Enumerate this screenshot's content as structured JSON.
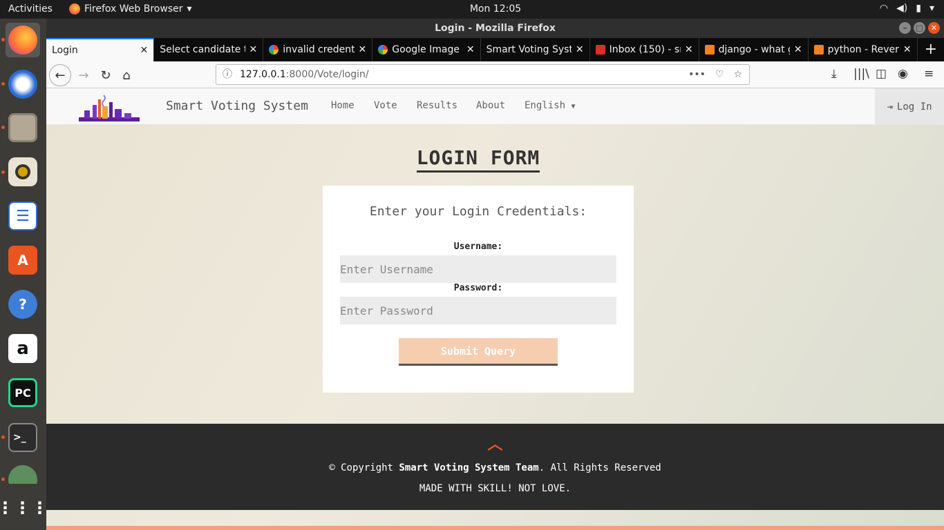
{
  "topbar": {
    "activities": "Activities",
    "app_name": "Firefox Web Browser",
    "clock": "Mon 12:05"
  },
  "window": {
    "title": "Login - Mozilla Firefox"
  },
  "tabs": [
    {
      "label": "Login",
      "active": true
    },
    {
      "label": "Select candidate t"
    },
    {
      "label": "invalid credent"
    },
    {
      "label": "Google Image"
    },
    {
      "label": "Smart Voting Syst"
    },
    {
      "label": "Inbox (150) - sr"
    },
    {
      "label": "django - what g"
    },
    {
      "label": "python - Rever"
    }
  ],
  "url": {
    "host": "127.0.0.1",
    "rest": ":8000/Vote/login/"
  },
  "site": {
    "brand": "Smart Voting System",
    "nav": [
      "Home",
      "Vote",
      "Results",
      "About",
      "English"
    ],
    "login": "Log In"
  },
  "form": {
    "title": "LOGIN FORM",
    "heading": "Enter your Login Credentials:",
    "username_label": "Username:",
    "username_placeholder": "Enter Username",
    "password_label": "Password:",
    "password_placeholder": "Enter Password",
    "submit": "Submit Query"
  },
  "footer": {
    "copy_prefix": "© Copyright",
    "copy_team": "Smart Voting System Team",
    "copy_suffix": ". All Rights Reserved",
    "tagline": "MADE WITH SKILL! NOT LOVE."
  }
}
